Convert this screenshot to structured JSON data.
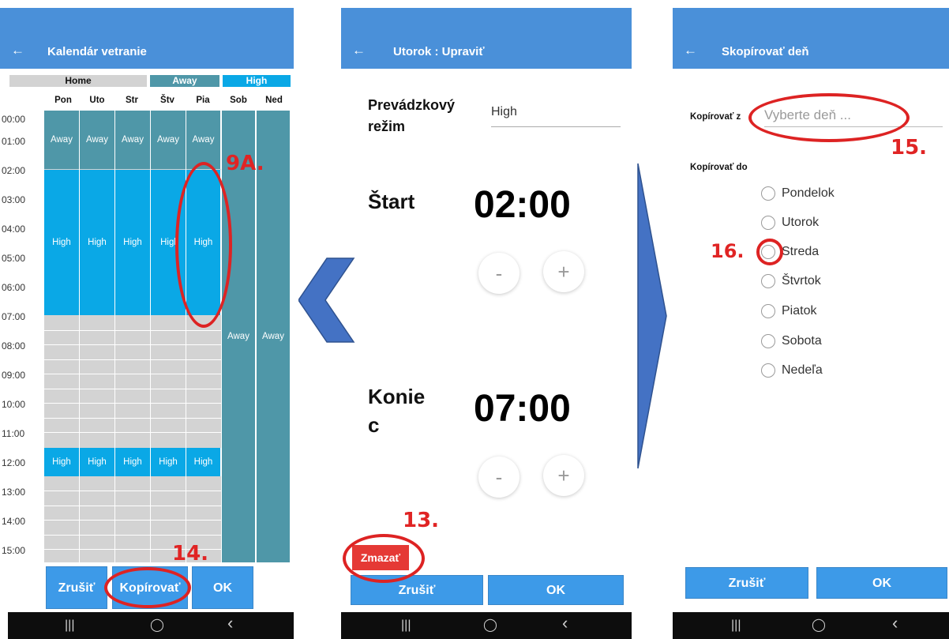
{
  "colors": {
    "home": "#d3d3d3",
    "away": "#4f97a8",
    "high": "#0aa8e6",
    "appbar": "#4a90d9",
    "button": "#3d9ae8",
    "delete": "#e53935",
    "annotation": "#e02424",
    "arrow": "#4472c4"
  },
  "nav_icons": [
    "recents-icon",
    "home-icon",
    "back-icon"
  ],
  "screen1": {
    "title": "Kalendár vetranie",
    "back": "←",
    "legend": {
      "home": "Home",
      "away": "Away",
      "high": "High"
    },
    "days": [
      "Pon",
      "Uto",
      "Str",
      "Štv",
      "Pia",
      "Sob",
      "Ned"
    ],
    "times": [
      "00:00",
      "01:00",
      "02:00",
      "03:00",
      "04:00",
      "05:00",
      "06:00",
      "07:00",
      "08:00",
      "09:00",
      "10:00",
      "11:00",
      "12:00",
      "13:00",
      "14:00",
      "15:00"
    ],
    "block_labels": {
      "away_morning": [
        "Away",
        "Away",
        "Away",
        "Away",
        "Away"
      ],
      "high_morning": [
        "High",
        "High",
        "High",
        "Higl",
        "High"
      ],
      "high_noon": [
        "High",
        "High",
        "High",
        "High",
        "High"
      ],
      "weekend": [
        "Away",
        "Away"
      ]
    },
    "cancel": "Zrušiť",
    "copy": "Kopírovať",
    "ok": "OK",
    "nav": {
      "recent": "|||",
      "home": "◯",
      "back": "‹"
    }
  },
  "screen2": {
    "title": "Utorok : Upraviť",
    "back": "←",
    "mode_label": "Prevádzkový režim",
    "mode_value": "High",
    "start_label": "Štart",
    "start_time": "02:00",
    "end_label": "Konie c",
    "end_time": "07:00",
    "minus": "-",
    "plus": "+",
    "delete": "Zmazať",
    "cancel": "Zrušiť",
    "ok": "OK",
    "nav": {
      "recent": "|||",
      "home": "◯",
      "back": "‹"
    }
  },
  "screen3": {
    "title": "Skopírovať deň",
    "back": "←",
    "copy_from_label": "Kopírovať z",
    "copy_from_placeholder": "Vyberte deň ...",
    "copy_to_label": "Kopírovať do",
    "days": [
      "Pondelok",
      "Utorok",
      "Streda",
      "Štvrtok",
      "Piatok",
      "Sobota",
      "Nedeľa"
    ],
    "cancel": "Zrušiť",
    "ok": "OK",
    "nav": {
      "recent": "|||",
      "home": "◯",
      "back": "‹"
    }
  },
  "annotations": {
    "a9": "9A.",
    "a13": "13.",
    "a14": "14.",
    "a15": "15.",
    "a16": "16."
  }
}
